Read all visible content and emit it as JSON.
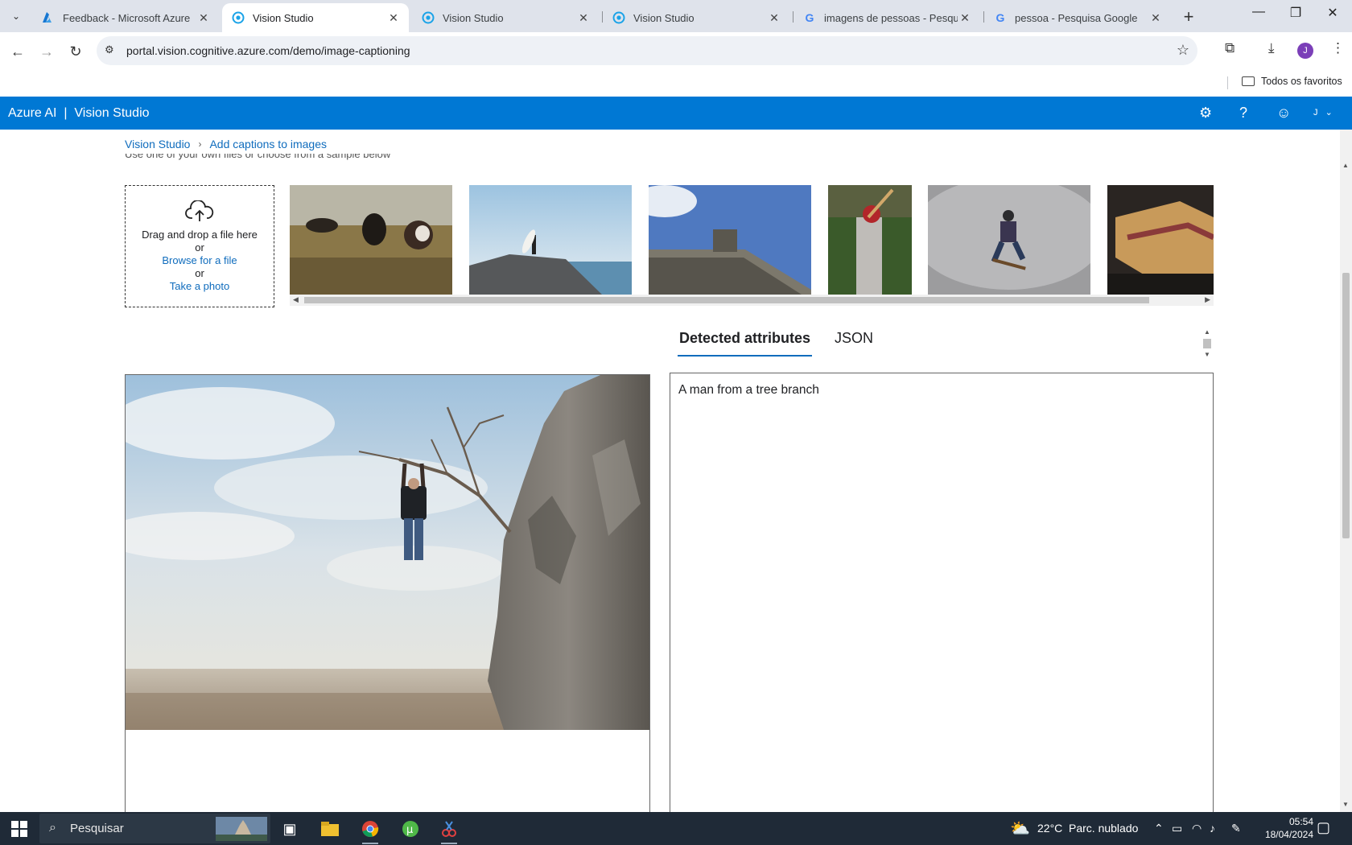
{
  "browser": {
    "tabs": [
      {
        "title": "Feedback - Microsoft Azure",
        "icon": "azure-icon",
        "active": false
      },
      {
        "title": "Vision Studio",
        "icon": "vision-studio-icon",
        "active": true
      },
      {
        "title": "Vision Studio",
        "icon": "vision-studio-icon",
        "active": false
      },
      {
        "title": "Vision Studio",
        "icon": "vision-studio-icon",
        "active": false
      },
      {
        "title": "imagens de pessoas - Pesquisa",
        "icon": "google-icon",
        "active": false
      },
      {
        "title": "pessoa - Pesquisa Google",
        "icon": "google-icon",
        "active": false
      }
    ],
    "url": "portal.vision.cognitive.azure.com/demo/image-captioning",
    "profile_initial": "J",
    "bookmarks_folder": "Todos os favoritos"
  },
  "app": {
    "brand": "Azure AI  |  Vision Studio",
    "user_initial": "J",
    "accent": "#0078d4"
  },
  "breadcrumb": {
    "home": "Vision Studio",
    "current": "Add captions to images"
  },
  "upload": {
    "drag_text": "Drag and drop a file here",
    "or1": "or",
    "browse": "Browse for a file",
    "or2": "or",
    "photo": "Take a photo",
    "cutoff_text": "Use one of your own files or choose from a sample below"
  },
  "samples": [
    "cows-in-field",
    "surfer-on-cliff",
    "building-statue",
    "baseball-batter",
    "skateboarder",
    "grilled-sandwich"
  ],
  "result_tabs": {
    "detected": "Detected attributes",
    "json": "JSON"
  },
  "result": {
    "caption": "A man from a tree branch"
  },
  "taskbar": {
    "search_placeholder": "Pesquisar",
    "weather_temp": "22°C",
    "weather_desc": "Parc. nublado",
    "time": "05:54",
    "date": "18/04/2024"
  }
}
